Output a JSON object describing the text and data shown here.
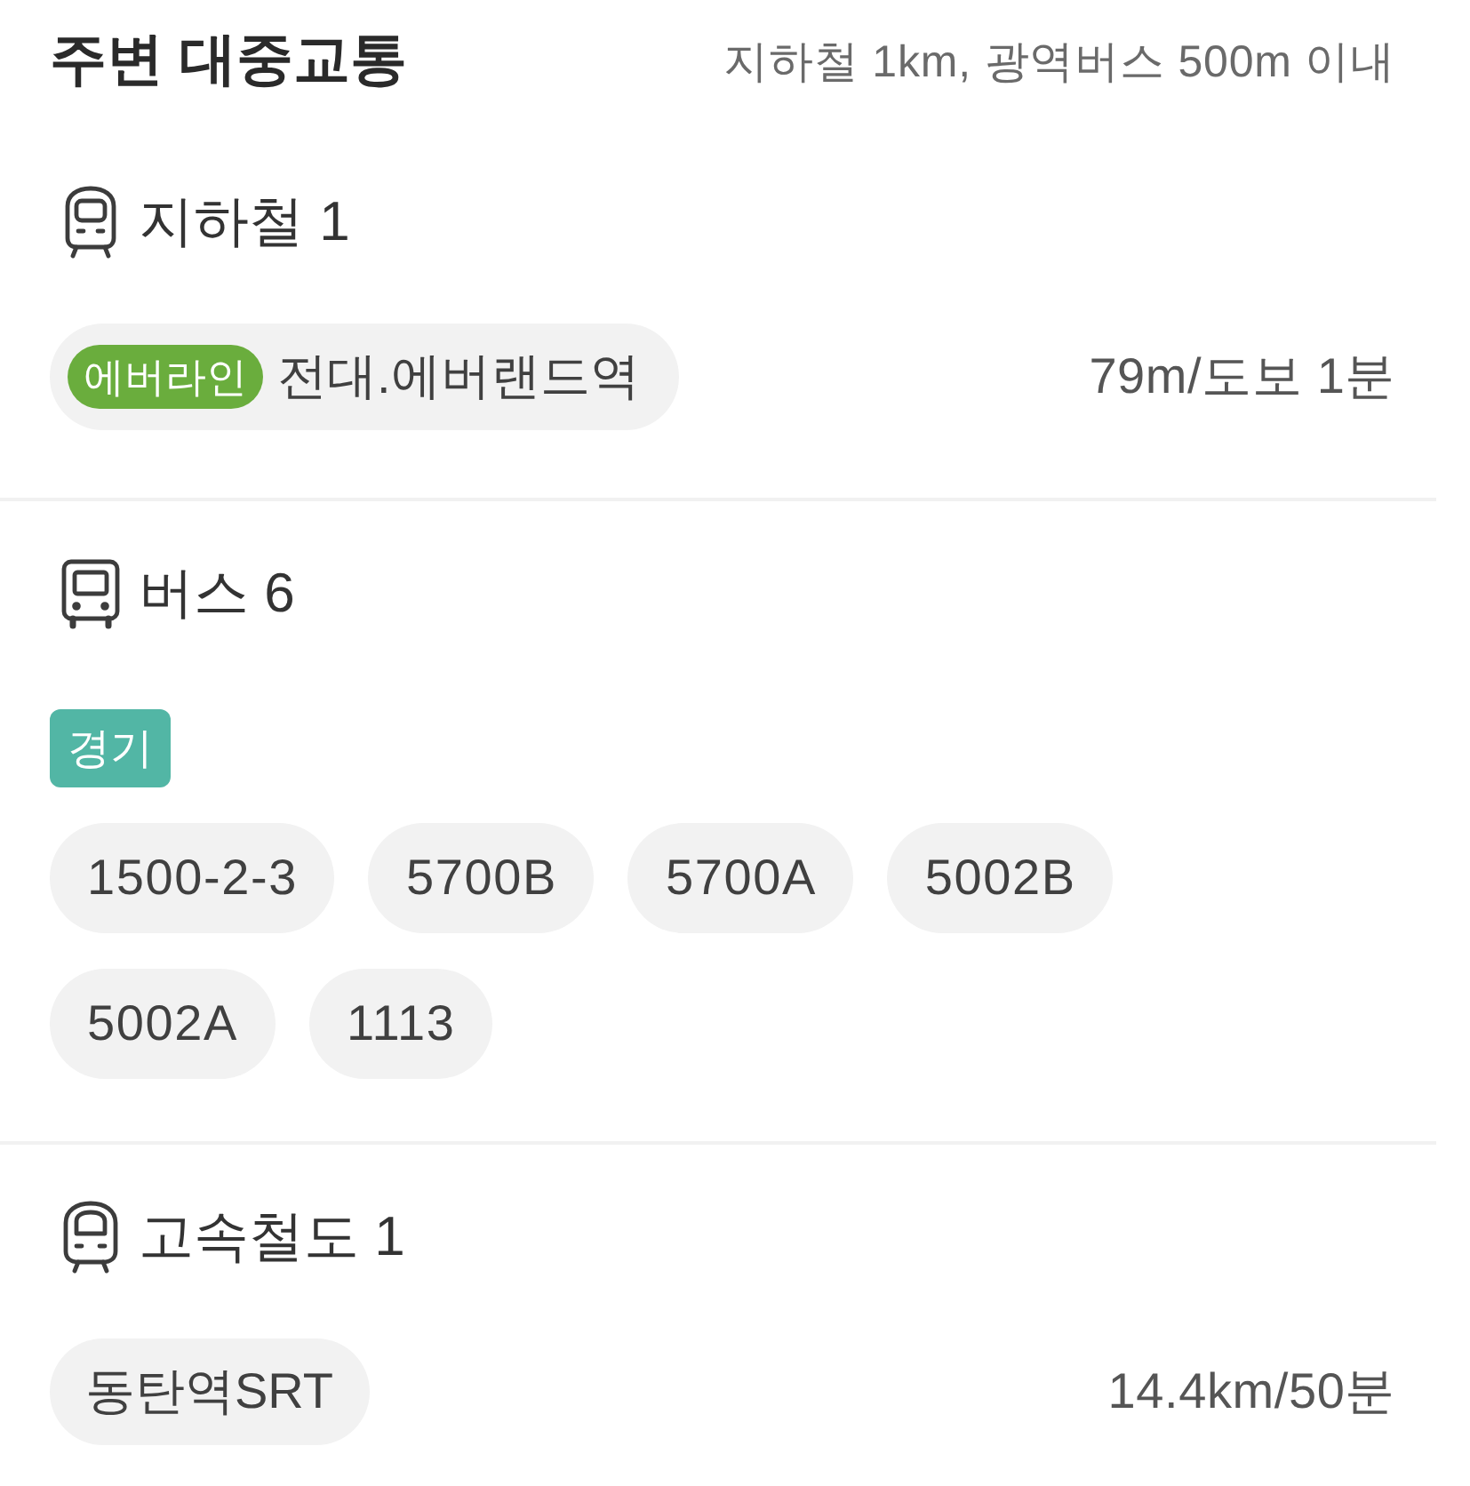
{
  "header": {
    "title": "주변 대중교통",
    "note": "지하철 1km, 광역버스 500m 이내"
  },
  "sections": [
    {
      "kind": "subway",
      "title": "지하철 1",
      "stations": [
        {
          "line": {
            "label": "에버라인",
            "color": "#6aad3d"
          },
          "name": "전대.에버랜드역",
          "distance": "79m/도보 1분"
        }
      ]
    },
    {
      "kind": "bus",
      "title": "버스 6",
      "groups": [
        {
          "region": {
            "label": "경기",
            "color": "#52b6a5"
          },
          "routes": [
            "1500-2-3",
            "5700B",
            "5700A",
            "5002B",
            "5002A",
            "1113"
          ]
        }
      ]
    },
    {
      "kind": "train",
      "title": "고속철도 1",
      "stations": [
        {
          "name": "동탄역SRT",
          "distance": "14.4km/50분"
        }
      ]
    }
  ]
}
